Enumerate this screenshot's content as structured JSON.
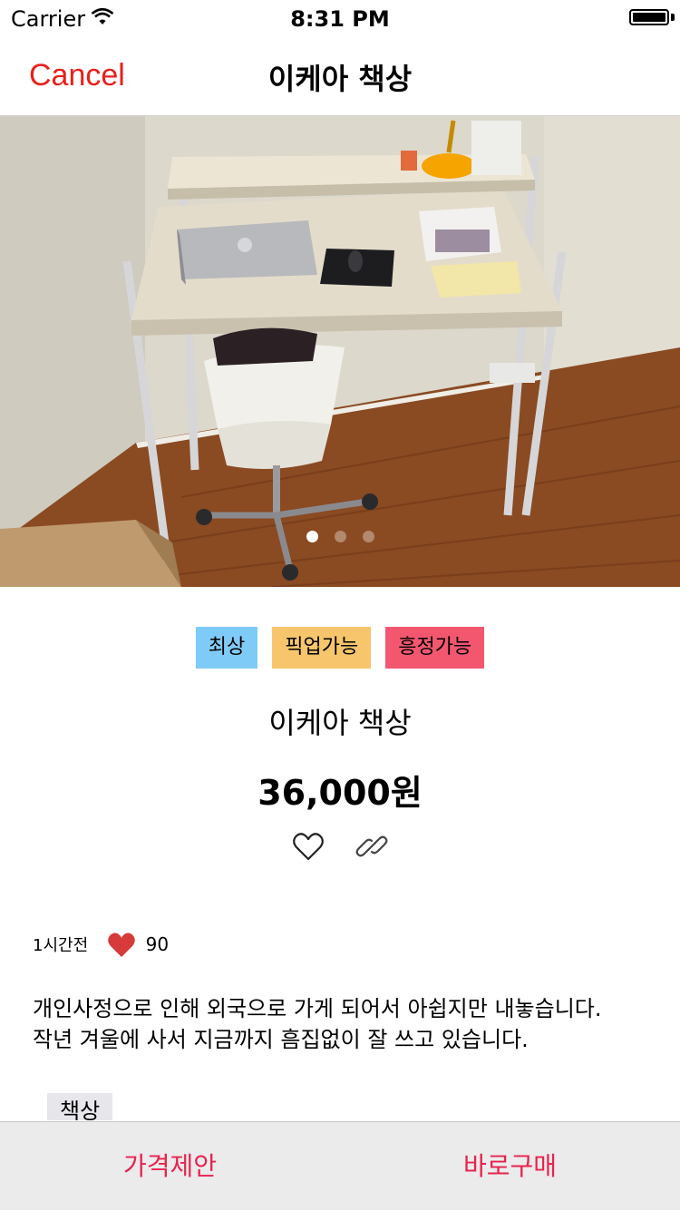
{
  "status_bar": {
    "carrier": "Carrier",
    "time": "8:31 PM",
    "wifi_icon": "wifi-icon",
    "battery_icon": "battery-icon"
  },
  "nav": {
    "cancel_label": "Cancel",
    "title": "이케아 책상"
  },
  "carousel": {
    "image_subject": "white metal desk with laptop on wooden floor",
    "page_count": 3,
    "current_page": 1
  },
  "tags": [
    {
      "label": "최상",
      "color": "#7fcbf8"
    },
    {
      "label": "픽업가능",
      "color": "#f7c56b"
    },
    {
      "label": "흥정가능",
      "color": "#f2576f"
    }
  ],
  "product": {
    "title": "이케아 책상",
    "price": "36,000원"
  },
  "actions": {
    "like_icon": "heart-outline-icon",
    "share_icon": "link-icon"
  },
  "meta": {
    "posted": "1시간전",
    "likes": "90",
    "heart_color": "#d63a3a"
  },
  "description": {
    "line1": "개인사정으로 인해 외국으로 가게 되어서 아쉽지만 내놓습니다.",
    "line2": "작년 겨울에 사서 지금까지 흠집없이 잘 쓰고 있습니다."
  },
  "keyword": "책상",
  "bottom_bar": {
    "offer_label": "가격제안",
    "buy_label": "바로구매",
    "accent": "#e8234f"
  }
}
